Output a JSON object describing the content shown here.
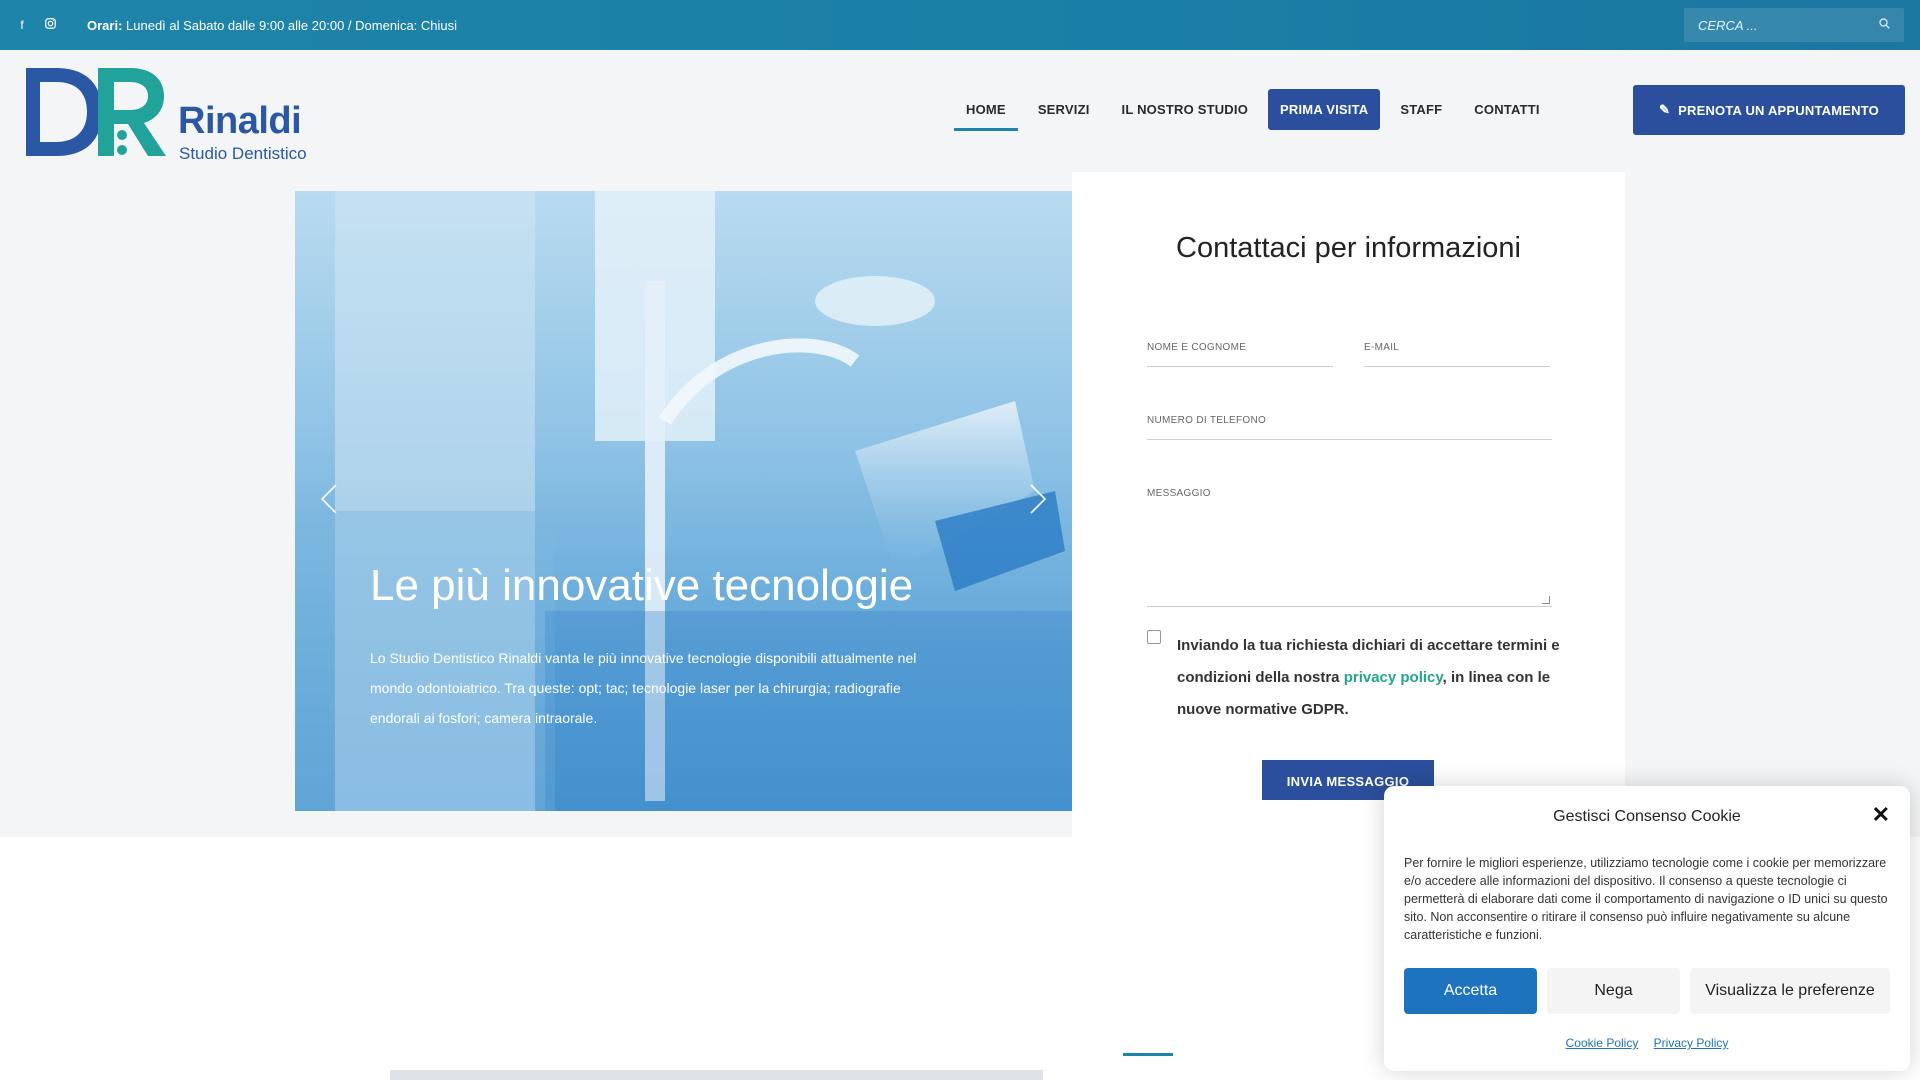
{
  "topbar": {
    "hours_label": "Orari:",
    "hours_text": " Lunedì al Sabato dalle 9:00 alle 20:00 / Domenica: Chiusi",
    "search_placeholder": "CERCA ...",
    "social": [
      "facebook-icon",
      "instagram-icon"
    ]
  },
  "brand": {
    "name": "Rinaldi",
    "subtitle": "Studio Dentistico",
    "color": "#2b58a5",
    "accent": "#21a39c"
  },
  "nav": {
    "items": [
      {
        "label": "HOME",
        "active": true
      },
      {
        "label": "SERVIZI"
      },
      {
        "label": "IL NOSTRO STUDIO"
      },
      {
        "label": "PRIMA VISITA",
        "highlight": true
      },
      {
        "label": "STAFF"
      },
      {
        "label": "CONTATTI"
      }
    ],
    "cta": "PRENOTA UN APPUNTAMENTO"
  },
  "hero": {
    "title": "Le più innovative tecnologie",
    "text": "Lo Studio Dentistico Rinaldi vanta le più innovative tecnologie disponibili attualmente nel mondo odontoiatrico. Tra queste: opt; tac; tecnologie laser per la chirurgia; radiografie endorali ai fosfori; camera intraorale."
  },
  "form": {
    "title": "Contattaci per informazioni",
    "name_label": "NOME E COGNOME",
    "email_label": "E-MAIL",
    "phone_label": "NUMERO DI TELEFONO",
    "message_label": "MESSAGGIO",
    "consent_before": "Inviando la tua richiesta dichiari di accettare termini e condizioni della nostra ",
    "consent_link": "privacy policy",
    "consent_after": ", in linea con le nuove normative GDPR.",
    "submit": "INVIA MESSAGGIO"
  },
  "cookie": {
    "title": "Gestisci Consenso Cookie",
    "body": "Per fornire le migliori esperienze, utilizziamo tecnologie come i cookie per memorizzare e/o accedere alle informazioni del dispositivo. Il consenso a queste tecnologie ci permetterà di elaborare dati come il comportamento di navigazione o ID unici su questo sito. Non acconsentire o ritirare il consenso può influire negativamente su alcune caratteristiche e funzioni.",
    "accept": "Accetta",
    "deny": "Nega",
    "preferences": "Visualizza le preferenze",
    "cookie_policy": "Cookie Policy",
    "privacy_policy": "Privacy Policy"
  }
}
